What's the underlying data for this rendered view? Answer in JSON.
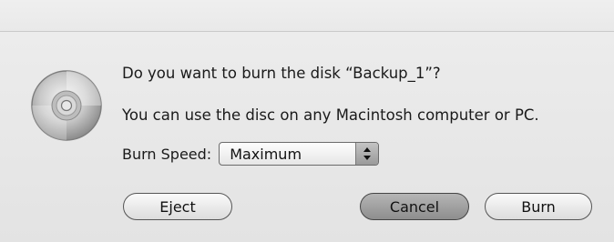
{
  "dialog": {
    "icon": "cd-disc-icon",
    "title_text": "Do you want to burn the disk “Backup_1”?",
    "body_text": "You can use the disc on any Macintosh computer or PC.",
    "burn_speed": {
      "label": "Burn Speed:",
      "selected": "Maximum"
    },
    "buttons": {
      "eject": "Eject",
      "cancel": "Cancel",
      "burn": "Burn"
    }
  }
}
